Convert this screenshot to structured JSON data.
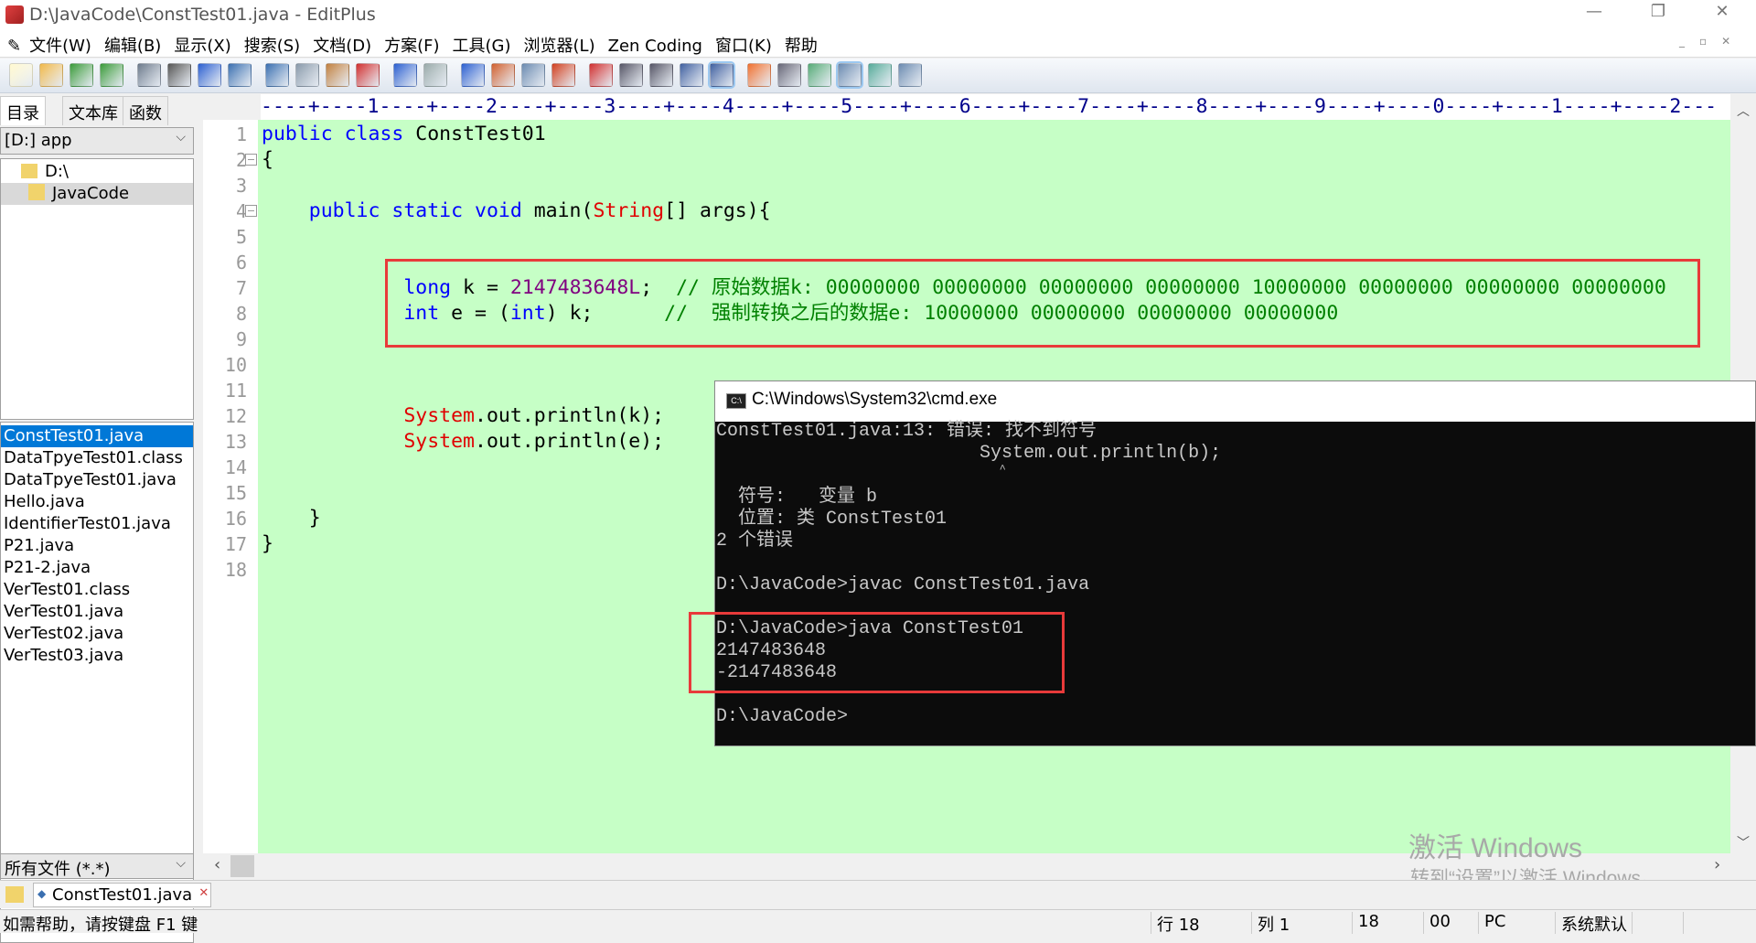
{
  "window": {
    "title": "D:\\JavaCode\\ConstTest01.java - EditPlus"
  },
  "menu": [
    "文件(W)",
    "编辑(B)",
    "显示(X)",
    "搜索(S)",
    "文档(D)",
    "方案(F)",
    "工具(G)",
    "浏览器(L)",
    "Zen Coding",
    "窗口(K)",
    "帮助"
  ],
  "toolbar": [
    "new-file",
    "open-file",
    "save",
    "save-all",
    "print-preview",
    "print",
    "spell-check",
    "browser-preview",
    "cut",
    "copy",
    "paste",
    "delete",
    "undo",
    "redo",
    "find",
    "replace",
    "goto",
    "line-numbers",
    "font",
    "hex",
    "word-wrap",
    "indent",
    "ruler",
    "check",
    "list-view",
    "directory",
    "cliptext",
    "output",
    "help"
  ],
  "sidebar": {
    "tabs": [
      "目录",
      "文本库",
      "函数"
    ],
    "drive": "[D:] app",
    "tree": [
      "D:\\",
      "JavaCode"
    ],
    "files": [
      "ConstTest01.java",
      "DataTpyeTest01.class",
      "DataTpyeTest01.java",
      "Hello.java",
      "IdentifierTest01.java",
      "P21.java",
      "P21-2.java",
      "VerTest01.class",
      "VerTest01.java",
      "VerTest02.java",
      "VerTest03.java"
    ],
    "selected_file": "ConstTest01.java",
    "filter": "所有文件 (*.*)"
  },
  "ruler": "----+----1----+----2----+----3----+----4----+----5----+----6----+----7----+----8----+----9----+----0----+----1----+----2---",
  "editor": {
    "line_numbers": [
      "1",
      "2",
      "3",
      "4",
      "5",
      "6",
      "7",
      "8",
      "9",
      "10",
      "11",
      "12",
      "13",
      "14",
      "15",
      "16",
      "17",
      "18"
    ],
    "code": {
      "l1a": "public class",
      "l1b": " ConstTest01",
      "l2": "{",
      "l4a": "    public static void",
      "l4b": " main(",
      "l4c": "String",
      "l4d": "[] args){",
      "l7a": "            long",
      "l7b": " k = ",
      "l7c": "2147483648L",
      "l7d": ";  ",
      "l7e": "// 原始数据k: 00000000 00000000 00000000 00000000 10000000 00000000 00000000 00000000",
      "l8a": "            int",
      "l8b": " e = (",
      "l8c": "int",
      "l8d": ") k;      ",
      "l8e": "//  强制转换之后的数据e: 10000000 00000000 00000000 00000000",
      "l12a": "            System",
      "l12b": ".out.println(k);",
      "l13a": "            System",
      "l13b": ".out.println(e);",
      "l16": "    }",
      "l17": "}"
    }
  },
  "cmd": {
    "title": "C:\\Windows\\System32\\cmd.exe",
    "lines": [
      "ConstTest01.java:13: 错误: 找不到符号",
      "                        System.out.println(b);",
      "                                           ^",
      "  符号:   变量 b",
      "  位置: 类 ConstTest01",
      "2 个错误",
      "",
      "D:\\JavaCode>javac ConstTest01.java",
      "",
      "D:\\JavaCode>java ConstTest01",
      "2147483648",
      "-2147483648",
      "",
      "D:\\JavaCode>"
    ]
  },
  "tabs": [
    "ConstTest01.java"
  ],
  "status": {
    "help": "如需帮助，请按键盘 F1 键",
    "row": "行 18",
    "col": "列 1",
    "lines": "18",
    "code": "00",
    "mode": "PC",
    "encoding": "系统默认"
  },
  "watermark": {
    "title": "激活 Windows",
    "subtitle": "转到“设置”以激活 Windows。"
  },
  "colors": {
    "editor_bg": "#c6ffc6",
    "keyword": "#0000ff",
    "number": "#800080",
    "comment": "#008000",
    "class": "#e00000",
    "highlight_box": "#e83a3a",
    "selection": "#0078d7"
  }
}
